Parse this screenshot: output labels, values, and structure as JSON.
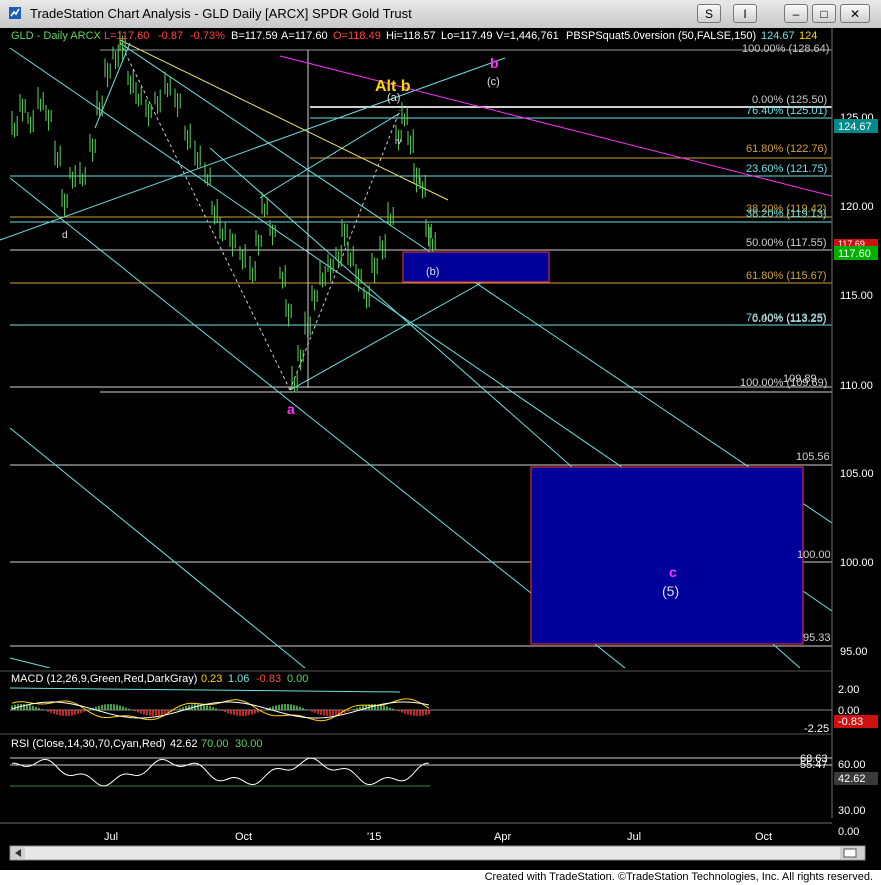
{
  "window": {
    "title": "TradeStation Chart Analysis - GLD Daily [ARCX] SPDR Gold Trust",
    "buttons": {
      "s": "S",
      "i": "I",
      "minimize": "–",
      "maximize": "□",
      "close": "✕"
    }
  },
  "header": {
    "symbol": "GLD - Daily  ARCX",
    "last": "L=117.60",
    "change": "-0.87",
    "change_pct": "-0.73%",
    "bid": "B=117.59",
    "ask": "A=117.60",
    "open": "O=118.49",
    "high": "Hi=118.57",
    "low": "Lo=117.49",
    "volume": "V=1,446,761",
    "study": "PBSPSquat5.0version (50,FALSE,150)",
    "extra1": "124.67",
    "extra2": "124"
  },
  "price_axis": {
    "labels": [
      "125.00",
      "120.00",
      "115.00",
      "110.00",
      "105.00",
      "100.00",
      "95.00"
    ],
    "last_price": "117.60",
    "upper_marker": "124.67",
    "hidden_marker": "117.69"
  },
  "fib_levels": [
    {
      "text": "100.00% (128.64)",
      "color": "#c8c8c8"
    },
    {
      "text": "0.00% (125.50)",
      "color": "#c8c8c8"
    },
    {
      "text": "76.40% (125.01)",
      "color": "#6ee0e0"
    },
    {
      "text": "61.80% (122.76)",
      "color": "#d2a23a"
    },
    {
      "text": "23.60% (121.75)",
      "color": "#6ee0e0"
    },
    {
      "text": "38.20% (119.42)",
      "color": "#d2a23a"
    },
    {
      "text": "38.20% (119.13)",
      "color": "#6ee0e0"
    },
    {
      "text": "50.00% (117.55)",
      "color": "#d2d2d2"
    },
    {
      "text": "61.80% (115.67)",
      "color": "#d2a23a"
    },
    {
      "text": "76.40% (113.25)",
      "color": "#6ee0e0"
    },
    {
      "text": "0.00% (113.25)",
      "color": "#d2d2d2"
    },
    {
      "text": "109.89",
      "color": "#d2d2d2"
    },
    {
      "text": "100.00% (109.69)",
      "color": "#d2d2d2"
    },
    {
      "text": "105.56",
      "color": "#d2d2d2"
    },
    {
      "text": "100.00",
      "color": "#d2d2d2"
    },
    {
      "text": "95.33",
      "color": "#d2d2d2"
    }
  ],
  "wave_labels": {
    "alt_b": "Alt b",
    "a_small": "(a)",
    "b_mag": "b",
    "c_small": "(c)",
    "b_small": "(b)",
    "a_mag": "a",
    "c_mag": "c",
    "five": "(5)",
    "d": "d",
    "iv": "iv"
  },
  "macd": {
    "label": "MACD (12,26,9,Green,Red,DarkGray)",
    "v1": "0.23",
    "v2": "1.06",
    "v3": "-0.83",
    "v4": "0.00",
    "axis": [
      "2.00",
      "0.00",
      "-2.25"
    ],
    "marker": "-0.83"
  },
  "rsi": {
    "label": "RSI (Close,14,30,70,Cyan,Red)",
    "v1": "42.62",
    "v2": "70.00",
    "v3": "30.00",
    "axis": [
      "68.63",
      "60.00",
      "55.47",
      "30.00",
      "0.00"
    ],
    "marker": "42.62"
  },
  "time_axis": [
    "Jul",
    "Oct",
    "'15",
    "Apr",
    "Jul",
    "Oct"
  ],
  "colors": {
    "price_bars": "#5fd35f",
    "target_box": "#000099",
    "box_border": "#ff3333",
    "cyan": "#6ee0e0",
    "magenta": "#ff33ff",
    "yellow_label": "#ffd700"
  },
  "footer": "Created with TradeStation. ©TradeStation Technologies, Inc. All rights reserved."
}
